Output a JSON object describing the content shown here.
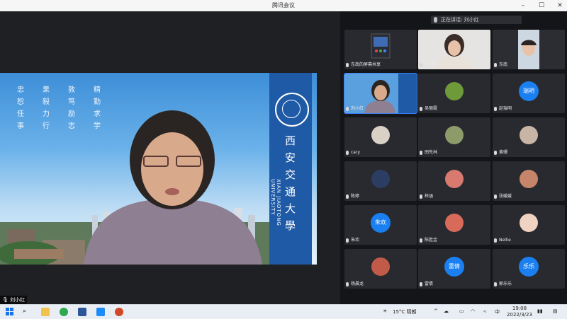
{
  "window": {
    "title": "腾讯会议"
  },
  "main": {
    "speaker_name": "刘小红",
    "motto_cols": [
      "忠恕任事",
      "果毅力行",
      "敦笃励志",
      "精勤求学"
    ],
    "uni_cn": "西安交通大學",
    "uni_en": "XIAN JIAOTONG UNIVERSITY"
  },
  "sidebar": {
    "speaking_label": "正在讲话: 刘小红",
    "tiles": [
      {
        "name": "东南的屏幕共享",
        "kind": "screen"
      },
      {
        "name": "丁老师",
        "kind": "video"
      },
      {
        "name": "东南",
        "kind": "video"
      },
      {
        "name": "刘小红",
        "kind": "video"
      },
      {
        "name": "吴丽霞",
        "kind": "avatar",
        "color": "#6f9a3a"
      },
      {
        "name": "赵瑞明",
        "kind": "text",
        "avatar": "瑞明"
      },
      {
        "name": "cary",
        "kind": "avatar",
        "color": "#d9d0c6"
      },
      {
        "name": "田先林",
        "kind": "avatar",
        "color": "#8d9a6a"
      },
      {
        "name": "黄珊",
        "kind": "avatar",
        "color": "#c9b5a6"
      },
      {
        "name": "陈婷",
        "kind": "avatar",
        "color": "#2c3d63"
      },
      {
        "name": "梓涵",
        "kind": "avatar",
        "color": "#d87a70"
      },
      {
        "name": "张媛媛",
        "kind": "avatar",
        "color": "#c6856a"
      },
      {
        "name": "朱欢",
        "kind": "text",
        "avatar": "朱欢"
      },
      {
        "name": "陈胜金",
        "kind": "avatar",
        "color": "#d86a5a"
      },
      {
        "name": "Nellie",
        "kind": "avatar",
        "color": "#f0d2c2"
      },
      {
        "name": "杨晨龙",
        "kind": "avatar",
        "color": "#c25a4a"
      },
      {
        "name": "雷倩",
        "kind": "text",
        "avatar": "雷倩"
      },
      {
        "name": "郭乐乐",
        "kind": "text",
        "avatar": "乐乐"
      }
    ]
  },
  "taskbar": {
    "weather": "15°C 晴朗",
    "ime": "中",
    "time": "19:08",
    "date": "2022/3/23"
  }
}
